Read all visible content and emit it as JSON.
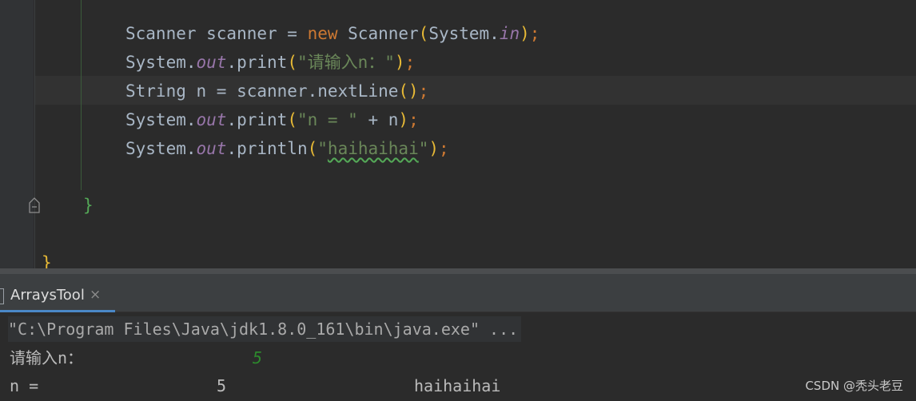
{
  "editor": {
    "lines": [
      [
        {
          "t": "Scanner scanner = ",
          "c": ""
        },
        {
          "t": "new",
          "c": "kw"
        },
        {
          "t": " Scanner",
          "c": ""
        },
        {
          "t": "(",
          "c": "paren"
        },
        {
          "t": "System.",
          "c": ""
        },
        {
          "t": "in",
          "c": "fld"
        },
        {
          "t": ")",
          "c": "paren"
        },
        {
          "t": ";",
          "c": "kw"
        }
      ],
      [
        {
          "t": "System.",
          "c": ""
        },
        {
          "t": "out",
          "c": "fld"
        },
        {
          "t": ".print",
          "c": ""
        },
        {
          "t": "(",
          "c": "paren"
        },
        {
          "t": "\"请输入n：\"",
          "c": "str"
        },
        {
          "t": ")",
          "c": "paren"
        },
        {
          "t": ";",
          "c": "kw"
        }
      ],
      [
        {
          "t": "String n = scanner.nextLine",
          "c": ""
        },
        {
          "t": "()",
          "c": "paren"
        },
        {
          "t": ";",
          "c": "kw"
        }
      ],
      [
        {
          "t": "System.",
          "c": ""
        },
        {
          "t": "out",
          "c": "fld"
        },
        {
          "t": ".print",
          "c": ""
        },
        {
          "t": "(",
          "c": "paren"
        },
        {
          "t": "\"n = \"",
          "c": "str"
        },
        {
          "t": " + n",
          "c": ""
        },
        {
          "t": ")",
          "c": "paren"
        },
        {
          "t": ";",
          "c": "kw"
        }
      ],
      [
        {
          "t": "System.",
          "c": ""
        },
        {
          "t": "out",
          "c": "fld"
        },
        {
          "t": ".println",
          "c": ""
        },
        {
          "t": "(",
          "c": "paren"
        },
        {
          "t": "\"",
          "c": "str"
        },
        {
          "t": "haihaihai",
          "c": "str typo"
        },
        {
          "t": "\"",
          "c": "str"
        },
        {
          "t": ")",
          "c": "paren"
        },
        {
          "t": ";",
          "c": "kw"
        }
      ]
    ],
    "inner_brace": "}",
    "outer_brace": "}"
  },
  "run_panel": {
    "tab_label": "ArraysTool",
    "tab_close": "×",
    "command_line": "\"C:\\Program Files\\Java\\jdk1.8.0_161\\bin\\java.exe\" ...",
    "prompt_text": "请输入n：",
    "input_value": "5",
    "output_label": "n =",
    "output_value": "5",
    "output_extra": "haihaihai"
  },
  "watermark": "CSDN @秃头老豆",
  "colors": {
    "editor_bg": "#2b2b2b",
    "keyword": "#cc7832",
    "string": "#6a8759",
    "field": "#9876aa",
    "bracket": "#e8ba36",
    "user_input": "#2c8a2c",
    "tab_accent": "#4a88c7"
  }
}
